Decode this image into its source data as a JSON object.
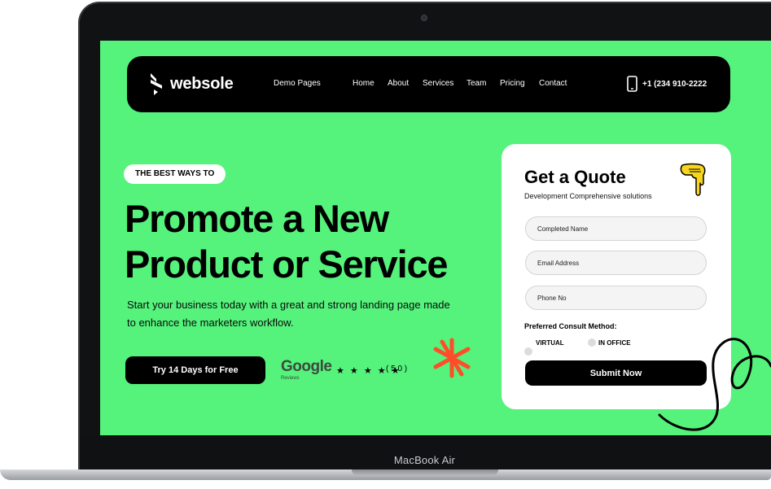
{
  "device": {
    "label": "MacBook Air"
  },
  "navbar": {
    "brand": "websole",
    "links": [
      "Demo Pages",
      "Home",
      "About",
      "Services",
      "Team",
      "Pricing",
      "Contact"
    ],
    "phone": "+1 (234 910-2222"
  },
  "hero": {
    "badge": "THE BEST WAYS TO",
    "title_line1": "Promote a New",
    "title_line2": "Product or Service",
    "description": "Start your business today with a great and strong landing page made to enhance the marketers workflow.",
    "cta": "Try 14 Days for Free",
    "reviews": {
      "brand": "Google",
      "sub": "Reviews",
      "stars": "★ ★ ★ ★ ★",
      "rating": "( 5.0 )"
    }
  },
  "quote_form": {
    "title": "Get a Quote",
    "subtitle": "Development Comprehensive solutions",
    "name_placeholder": "Completed Name",
    "email_placeholder": "Email Address",
    "phone_placeholder": "Phone No",
    "method_label": "Preferred Consult Method:",
    "option_virtual": "VIRTUAL",
    "option_office": "IN OFFICE",
    "submit": "Submit Now"
  },
  "colors": {
    "screen_bg": "#55f27c",
    "accent_orange": "#ff4d2a",
    "hand_yellow": "#f7d51a"
  }
}
